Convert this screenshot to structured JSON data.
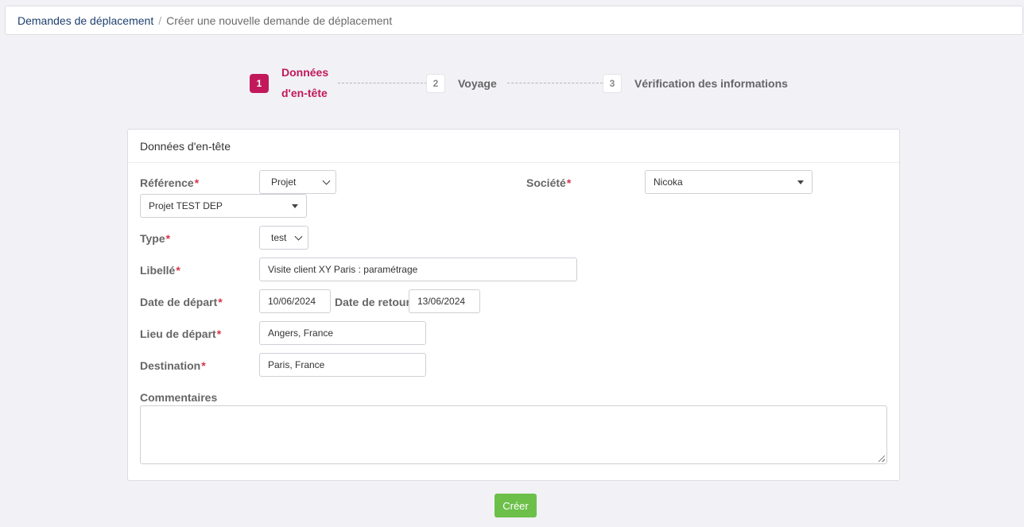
{
  "breadcrumb": {
    "parent": "Demandes de déplacement",
    "separator": "/",
    "current": "Créer une nouvelle demande de déplacement"
  },
  "stepper": {
    "steps": [
      {
        "number": "1",
        "label_line1": "Données",
        "label_line2": "d'en-tête",
        "state": "active"
      },
      {
        "number": "2",
        "label": "Voyage",
        "state": "inactive"
      },
      {
        "number": "3",
        "label": "Vérification des informations",
        "state": "inactive"
      }
    ]
  },
  "panel": {
    "title": "Données d'en-tête"
  },
  "form": {
    "required_mark": "*",
    "reference": {
      "label": "Référence",
      "type_value": "Projet",
      "project_value": "Projet TEST DEP"
    },
    "societe": {
      "label": "Société",
      "value": "Nicoka"
    },
    "type": {
      "label": "Type",
      "value": "test"
    },
    "libelle": {
      "label": "Libellé",
      "value": "Visite client XY Paris : paramétrage"
    },
    "date_depart": {
      "label": "Date de départ",
      "value": "10/06/2024"
    },
    "date_retour": {
      "label": "Date de retour",
      "value": "13/06/2024"
    },
    "lieu_depart": {
      "label": "Lieu de départ",
      "value": "Angers, France"
    },
    "destination": {
      "label": "Destination",
      "value": "Paris, France"
    },
    "commentaires": {
      "label": "Commentaires",
      "value": ""
    }
  },
  "actions": {
    "create_label": "Créer"
  },
  "colors": {
    "accent": "#c2185b",
    "create_button": "#6cc04a",
    "required": "#d9324a",
    "breadcrumb_link": "#1d3f6e"
  }
}
